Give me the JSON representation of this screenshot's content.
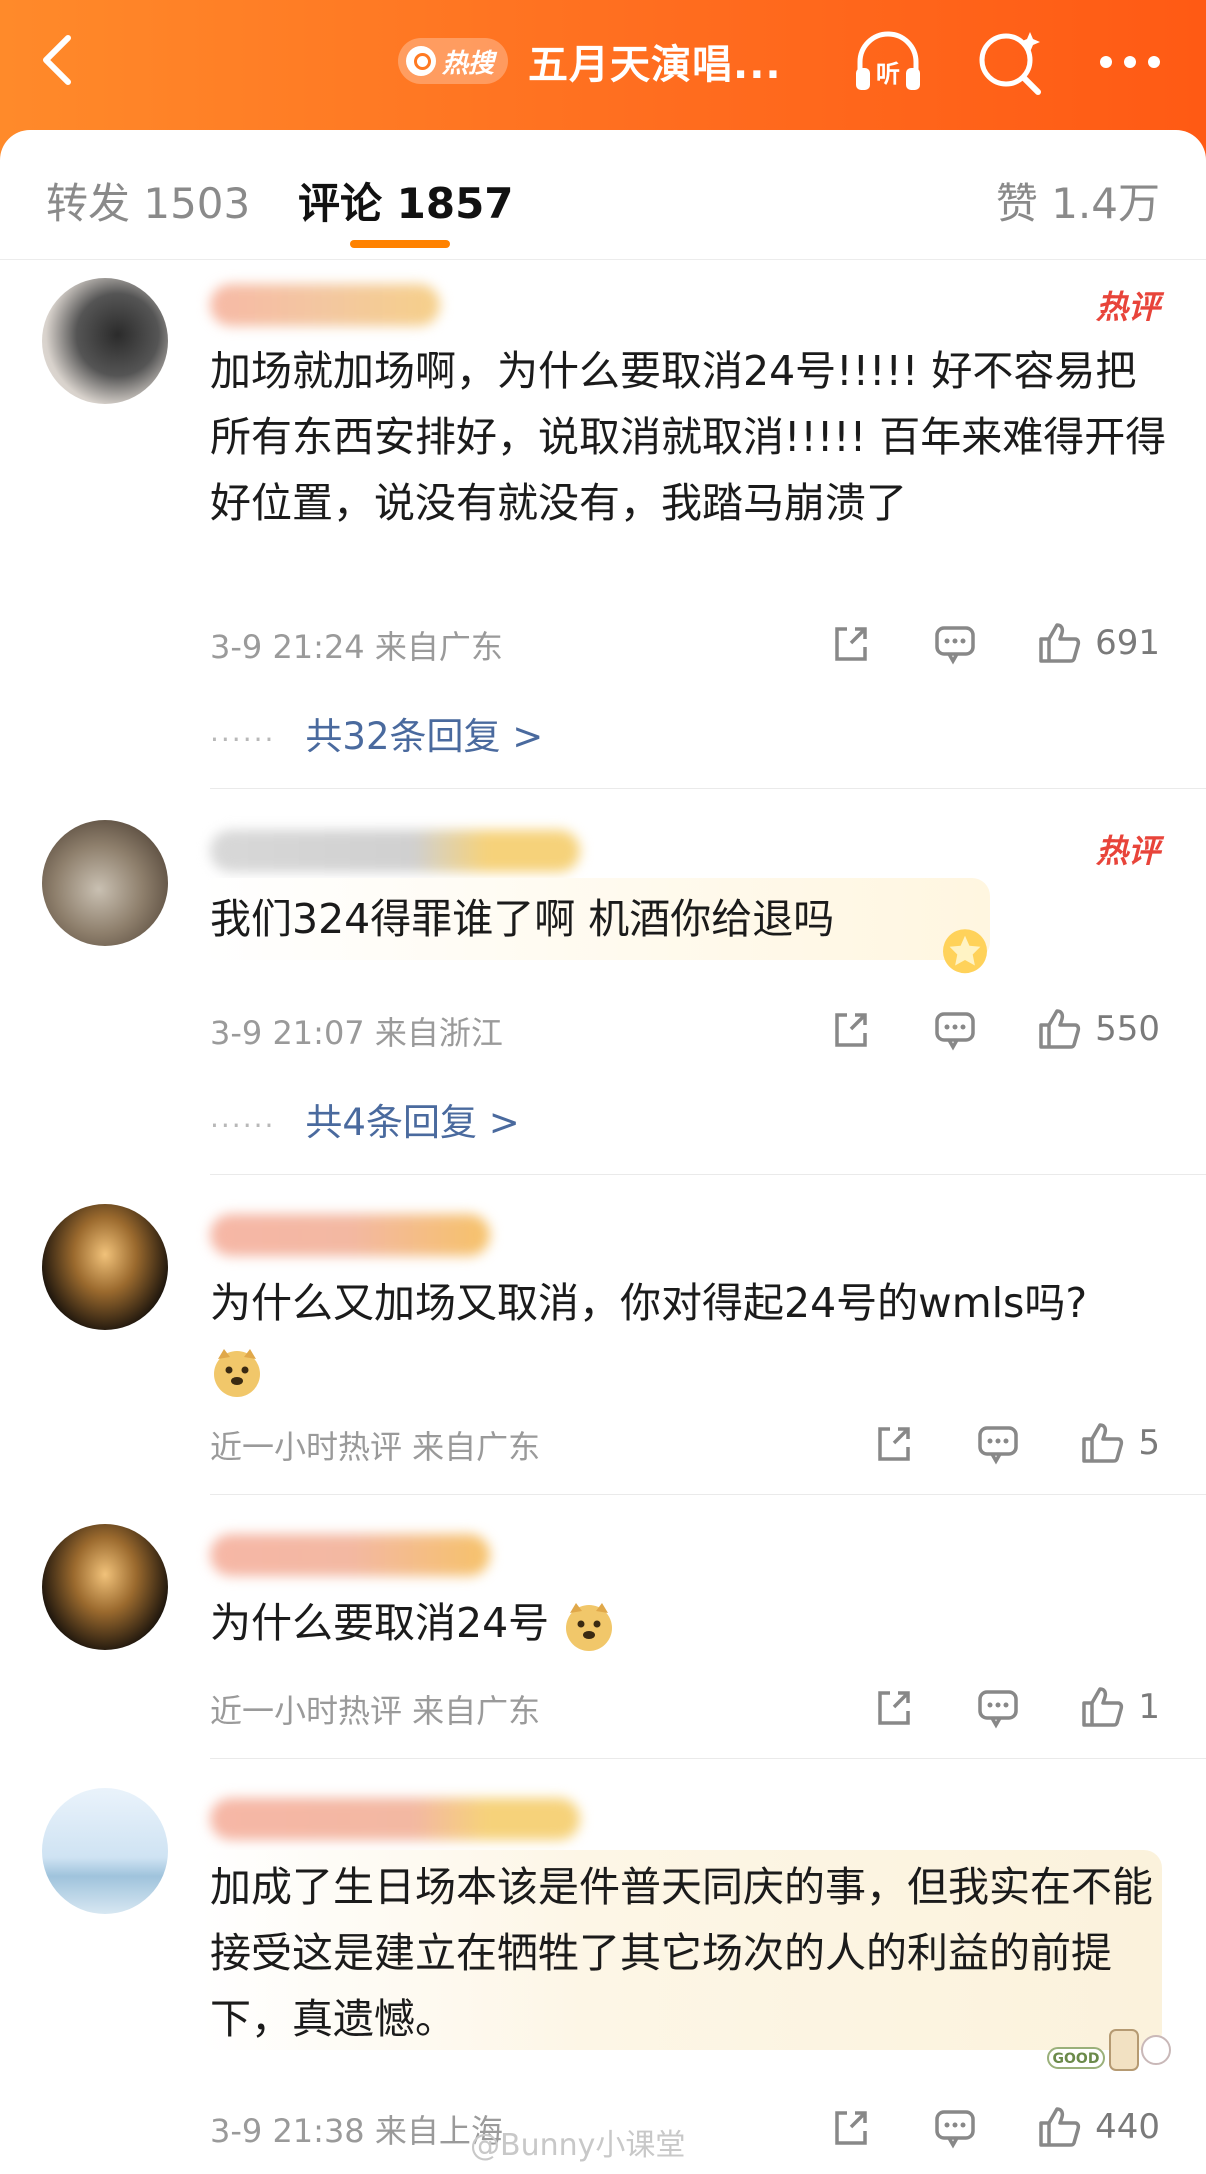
{
  "topbar": {
    "hot_label": "热搜",
    "title": "五月天演唱..."
  },
  "tabs": {
    "repost": "转发 1503",
    "comment": "评论 1857",
    "like": "赞 1.4万"
  },
  "comments": [
    {
      "hot_tag": "热评",
      "text": "加场就加场啊，为什么要取消24号!!!!! 好不容易把所有东西安排好，说取消就取消!!!!! 百年来难得开得好位置，说没有就没有，我踏马崩溃了",
      "meta": "3-9 21:24  来自广东",
      "likes": "691",
      "replies": "共32条回复 >"
    },
    {
      "hot_tag": "热评",
      "text": "我们324得罪谁了啊 机酒你给退吗",
      "meta": "3-9 21:07  来自浙江",
      "likes": "550",
      "replies": "共4条回复 >"
    },
    {
      "text": "为什么又加场又取消，你对得起24号的wmls吗?",
      "meta": "近一小时热评  来自广东",
      "likes": "5"
    },
    {
      "text": "为什么要取消24号",
      "meta": "近一小时热评  来自广东",
      "likes": "1"
    },
    {
      "text": "加成了生日场本该是件普天同庆的事，但我实在不能接受这是建立在牺牲了其它场次的人的利益的前提下，真遗憾。",
      "meta": "3-9 21:38  来自上海",
      "likes": "440"
    }
  ],
  "watermark": "@Bunny小课堂",
  "reply_dots": "······",
  "colors": {
    "accent": "#ff8200",
    "hot_red": "#e8443a",
    "link_blue": "#4a6a9e"
  }
}
